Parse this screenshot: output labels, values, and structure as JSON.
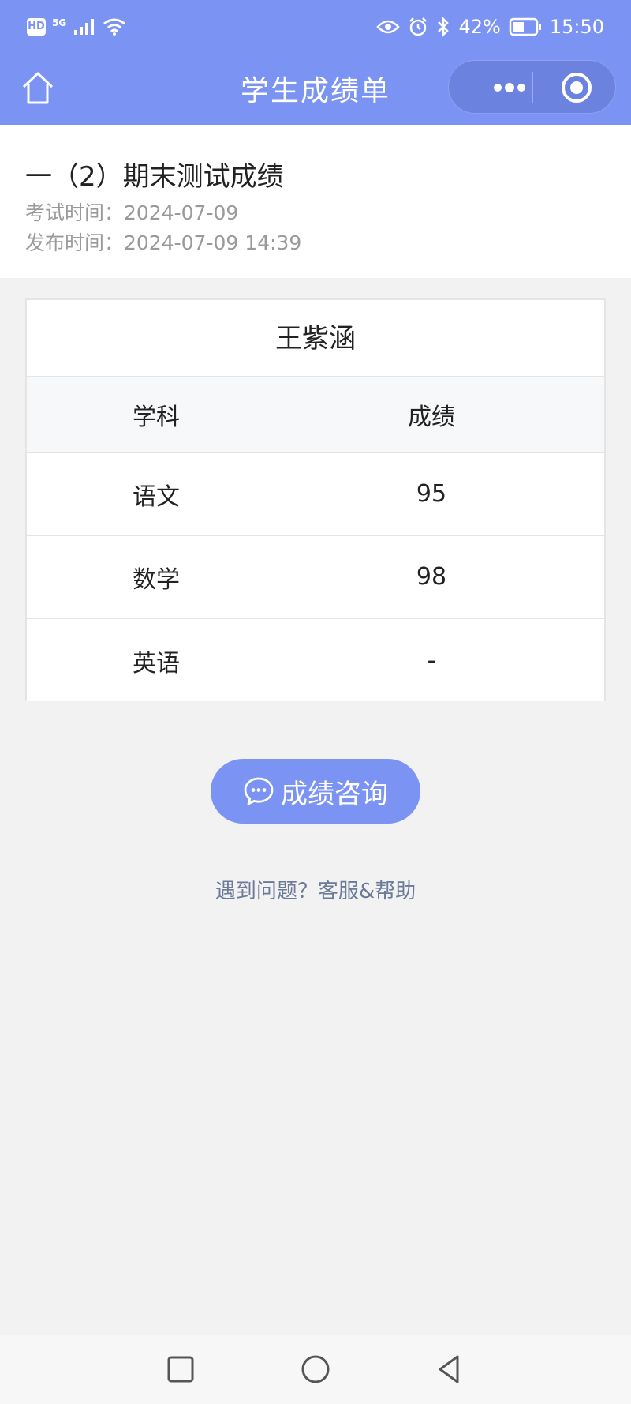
{
  "status_bar": {
    "hd_badge": "HD",
    "network": "5G",
    "battery": "42%",
    "time": "15:50"
  },
  "nav": {
    "title": "学生成绩单"
  },
  "exam": {
    "title": "一（2）期末测试成绩",
    "exam_time": "考试时间：2024-07-09",
    "publish_time": "发布时间：2024-07-09 14:39"
  },
  "scores": {
    "student_name": "王紫涵",
    "headers": [
      "学科",
      "成绩"
    ],
    "rows": [
      {
        "subject": "语文",
        "score": "95"
      },
      {
        "subject": "数学",
        "score": "98"
      },
      {
        "subject": "英语",
        "score": "-"
      }
    ]
  },
  "actions": {
    "consult_label": "成绩咨询",
    "help_link": "遇到问题？客服&帮助"
  },
  "theme": {
    "accent": "#7b93f3",
    "capsule": "#6c82df"
  }
}
